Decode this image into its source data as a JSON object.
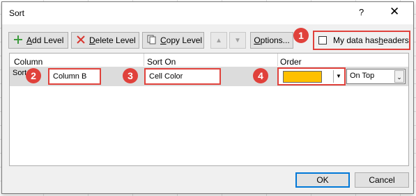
{
  "dialog": {
    "title": "Sort",
    "help": "?",
    "close": "✕"
  },
  "toolbar": {
    "add_level": {
      "underline": "A",
      "rest": "dd Level"
    },
    "delete_level": {
      "underline": "D",
      "rest": "elete Level"
    },
    "copy_level": {
      "underline": "C",
      "rest": "opy Level"
    },
    "move_up": "▲",
    "move_down": "▼",
    "options": {
      "underline": "O",
      "rest": "ptions..."
    },
    "headers": {
      "prefix": "My data has ",
      "underline": "h",
      "rest": "eaders",
      "checked": false
    }
  },
  "columns": {
    "column": "Column",
    "sort_on": "Sort On",
    "order": "Order"
  },
  "row": {
    "label": "Sort by",
    "column_value": "Column B",
    "sort_on_value": "Cell Color",
    "order_color": "#FFC000",
    "order_position": "On Top"
  },
  "badges": [
    "1",
    "2",
    "3",
    "4"
  ],
  "footer": {
    "ok": "OK",
    "cancel": "Cancel"
  },
  "colors": {
    "accent_red": "#E0413B",
    "swatch": "#FFC000",
    "ok_border": "#0078D7"
  }
}
